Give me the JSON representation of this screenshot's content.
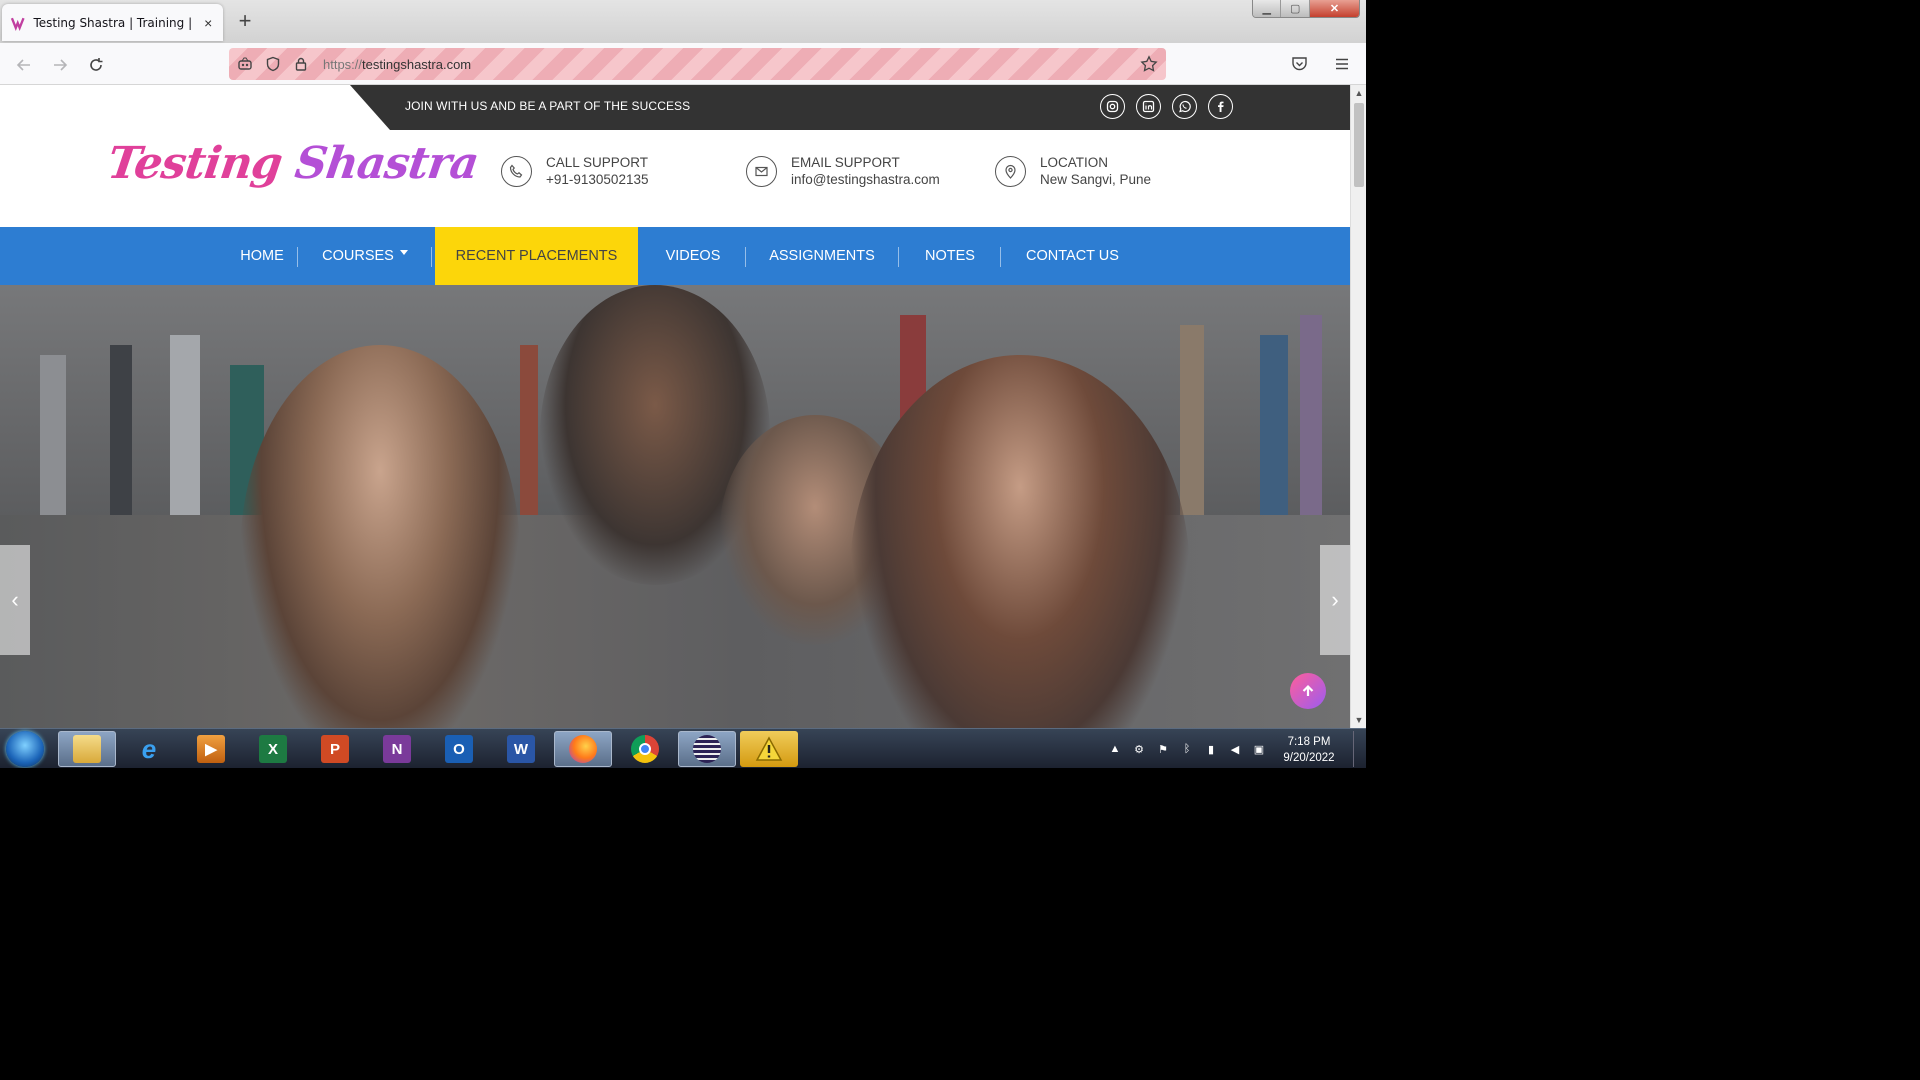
{
  "browser": {
    "tab_title": "Testing Shastra | Training | Placement",
    "tab_close": "×",
    "new_tab": "+",
    "url_protocol": "https://",
    "url_host": "testingshastra.com"
  },
  "site": {
    "tagline": "JOIN WITH US AND BE A PART OF THE SUCCESS",
    "logo_word1": "Testing",
    "logo_word2": "Shastra",
    "call_title": "CALL SUPPORT",
    "call_value": "+91-9130502135",
    "email_title": "EMAIL SUPPORT",
    "email_value": "info@testingshastra.com",
    "location_title": "LOCATION",
    "location_value": "New Sangvi, Pune",
    "menu": {
      "home": "HOME",
      "courses": "COURSES",
      "placements": "RECENT PLACEMENTS",
      "videos": "VIDEOS",
      "assignments": "ASSIGNMENTS",
      "notes": "NOTES",
      "contact": "CONTACT US"
    },
    "colors": {
      "menu_bar": "#2d7dd2",
      "active_item": "#fcd60a",
      "top_strip": "#333333",
      "logo": "#e0409a"
    }
  },
  "taskbar": {
    "time": "7:18 PM",
    "date": "9/20/2022",
    "apps": [
      "file-explorer",
      "internet-explorer",
      "media-player",
      "excel",
      "powerpoint",
      "onenote",
      "outlook",
      "word",
      "firefox",
      "chrome",
      "eclipse",
      "warning"
    ]
  }
}
